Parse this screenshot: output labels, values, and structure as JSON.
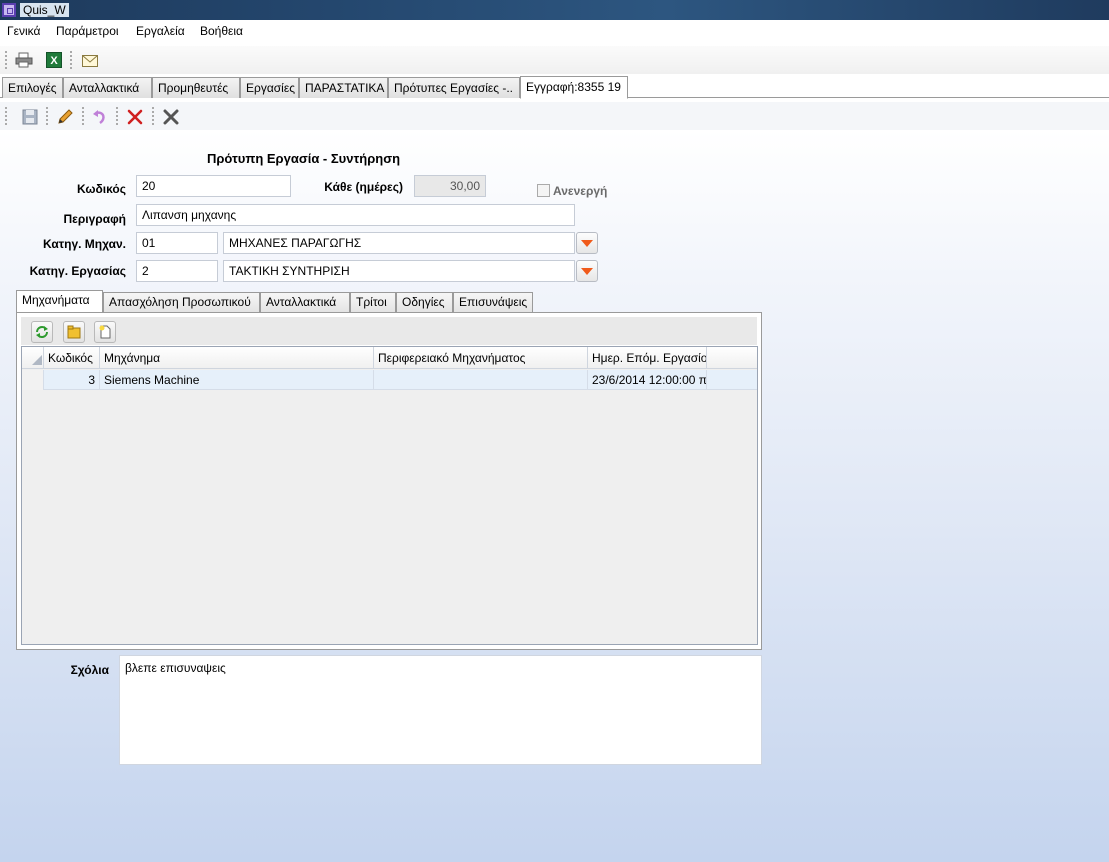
{
  "window": {
    "title": "Quis_W"
  },
  "menu": [
    "Γενικά",
    "Παράμετροι",
    "Εργαλεία",
    "Βοήθεια"
  ],
  "main_tabs": [
    "Επιλογές",
    "Ανταλλακτικά",
    "Προμηθευτές",
    "Εργασίες",
    "ΠΑΡΑΣΤΑΤΙΚΑ",
    "Πρότυπες Εργασίες -..",
    "Εγγραφή:8355 19"
  ],
  "form": {
    "heading": "Πρότυπη Εργασία - Συντήρηση",
    "code_label": "Κωδικός",
    "code_value": "20",
    "every_label": "Κάθε (ημέρες)",
    "every_value": "30,00",
    "inactive_label": "Ανενεργή",
    "desc_label": "Περιγραφή",
    "desc_value": "Λιπανση μηχανης",
    "machine_cat_label": "Κατηγ. Μηχαν.",
    "machine_cat_code": "01",
    "machine_cat_name": "ΜΗΧΑΝΕΣ ΠΑΡΑΓΩΓΗΣ",
    "job_cat_label": "Κατηγ. Εργασίας",
    "job_cat_code": "2",
    "job_cat_name": "ΤΑΚΤΙΚΗ ΣΥΝΤΗΡΙΣΗ",
    "notes_label": "Σχόλια",
    "notes_value": "βλεπε επισυναψεις"
  },
  "inner_tabs": [
    "Μηχανήματα",
    "Απασχόληση Προσωπικού",
    "Ανταλλακτικά",
    "Τρίτοι",
    "Οδηγίες",
    "Επισυνάψεις"
  ],
  "grid": {
    "headers": [
      "Κωδικός",
      "Μηχάνημα",
      "Περιφερειακό Μηχανήματος",
      "Ημερ. Επόμ. Εργασίο"
    ],
    "rows": [
      [
        "3",
        "Siemens Machine",
        "",
        "23/6/2014 12:00:00 π"
      ]
    ]
  },
  "colors": {
    "dropdown_arrow": "#f05a1a",
    "delete_red": "#d02020",
    "accent_blue": "#c4d4ee"
  }
}
